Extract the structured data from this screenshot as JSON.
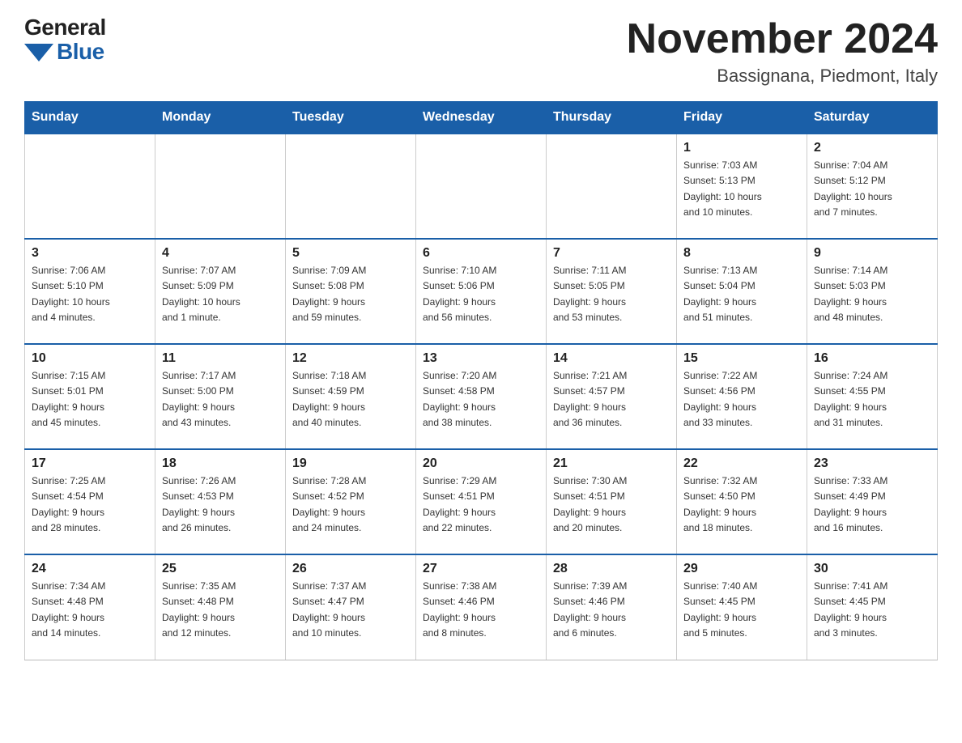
{
  "logo": {
    "general": "General",
    "blue": "Blue"
  },
  "title": {
    "month": "November 2024",
    "location": "Bassignana, Piedmont, Italy"
  },
  "days_of_week": [
    "Sunday",
    "Monday",
    "Tuesday",
    "Wednesday",
    "Thursday",
    "Friday",
    "Saturday"
  ],
  "weeks": [
    [
      {
        "day": "",
        "info": ""
      },
      {
        "day": "",
        "info": ""
      },
      {
        "day": "",
        "info": ""
      },
      {
        "day": "",
        "info": ""
      },
      {
        "day": "",
        "info": ""
      },
      {
        "day": "1",
        "info": "Sunrise: 7:03 AM\nSunset: 5:13 PM\nDaylight: 10 hours\nand 10 minutes."
      },
      {
        "day": "2",
        "info": "Sunrise: 7:04 AM\nSunset: 5:12 PM\nDaylight: 10 hours\nand 7 minutes."
      }
    ],
    [
      {
        "day": "3",
        "info": "Sunrise: 7:06 AM\nSunset: 5:10 PM\nDaylight: 10 hours\nand 4 minutes."
      },
      {
        "day": "4",
        "info": "Sunrise: 7:07 AM\nSunset: 5:09 PM\nDaylight: 10 hours\nand 1 minute."
      },
      {
        "day": "5",
        "info": "Sunrise: 7:09 AM\nSunset: 5:08 PM\nDaylight: 9 hours\nand 59 minutes."
      },
      {
        "day": "6",
        "info": "Sunrise: 7:10 AM\nSunset: 5:06 PM\nDaylight: 9 hours\nand 56 minutes."
      },
      {
        "day": "7",
        "info": "Sunrise: 7:11 AM\nSunset: 5:05 PM\nDaylight: 9 hours\nand 53 minutes."
      },
      {
        "day": "8",
        "info": "Sunrise: 7:13 AM\nSunset: 5:04 PM\nDaylight: 9 hours\nand 51 minutes."
      },
      {
        "day": "9",
        "info": "Sunrise: 7:14 AM\nSunset: 5:03 PM\nDaylight: 9 hours\nand 48 minutes."
      }
    ],
    [
      {
        "day": "10",
        "info": "Sunrise: 7:15 AM\nSunset: 5:01 PM\nDaylight: 9 hours\nand 45 minutes."
      },
      {
        "day": "11",
        "info": "Sunrise: 7:17 AM\nSunset: 5:00 PM\nDaylight: 9 hours\nand 43 minutes."
      },
      {
        "day": "12",
        "info": "Sunrise: 7:18 AM\nSunset: 4:59 PM\nDaylight: 9 hours\nand 40 minutes."
      },
      {
        "day": "13",
        "info": "Sunrise: 7:20 AM\nSunset: 4:58 PM\nDaylight: 9 hours\nand 38 minutes."
      },
      {
        "day": "14",
        "info": "Sunrise: 7:21 AM\nSunset: 4:57 PM\nDaylight: 9 hours\nand 36 minutes."
      },
      {
        "day": "15",
        "info": "Sunrise: 7:22 AM\nSunset: 4:56 PM\nDaylight: 9 hours\nand 33 minutes."
      },
      {
        "day": "16",
        "info": "Sunrise: 7:24 AM\nSunset: 4:55 PM\nDaylight: 9 hours\nand 31 minutes."
      }
    ],
    [
      {
        "day": "17",
        "info": "Sunrise: 7:25 AM\nSunset: 4:54 PM\nDaylight: 9 hours\nand 28 minutes."
      },
      {
        "day": "18",
        "info": "Sunrise: 7:26 AM\nSunset: 4:53 PM\nDaylight: 9 hours\nand 26 minutes."
      },
      {
        "day": "19",
        "info": "Sunrise: 7:28 AM\nSunset: 4:52 PM\nDaylight: 9 hours\nand 24 minutes."
      },
      {
        "day": "20",
        "info": "Sunrise: 7:29 AM\nSunset: 4:51 PM\nDaylight: 9 hours\nand 22 minutes."
      },
      {
        "day": "21",
        "info": "Sunrise: 7:30 AM\nSunset: 4:51 PM\nDaylight: 9 hours\nand 20 minutes."
      },
      {
        "day": "22",
        "info": "Sunrise: 7:32 AM\nSunset: 4:50 PM\nDaylight: 9 hours\nand 18 minutes."
      },
      {
        "day": "23",
        "info": "Sunrise: 7:33 AM\nSunset: 4:49 PM\nDaylight: 9 hours\nand 16 minutes."
      }
    ],
    [
      {
        "day": "24",
        "info": "Sunrise: 7:34 AM\nSunset: 4:48 PM\nDaylight: 9 hours\nand 14 minutes."
      },
      {
        "day": "25",
        "info": "Sunrise: 7:35 AM\nSunset: 4:48 PM\nDaylight: 9 hours\nand 12 minutes."
      },
      {
        "day": "26",
        "info": "Sunrise: 7:37 AM\nSunset: 4:47 PM\nDaylight: 9 hours\nand 10 minutes."
      },
      {
        "day": "27",
        "info": "Sunrise: 7:38 AM\nSunset: 4:46 PM\nDaylight: 9 hours\nand 8 minutes."
      },
      {
        "day": "28",
        "info": "Sunrise: 7:39 AM\nSunset: 4:46 PM\nDaylight: 9 hours\nand 6 minutes."
      },
      {
        "day": "29",
        "info": "Sunrise: 7:40 AM\nSunset: 4:45 PM\nDaylight: 9 hours\nand 5 minutes."
      },
      {
        "day": "30",
        "info": "Sunrise: 7:41 AM\nSunset: 4:45 PM\nDaylight: 9 hours\nand 3 minutes."
      }
    ]
  ]
}
